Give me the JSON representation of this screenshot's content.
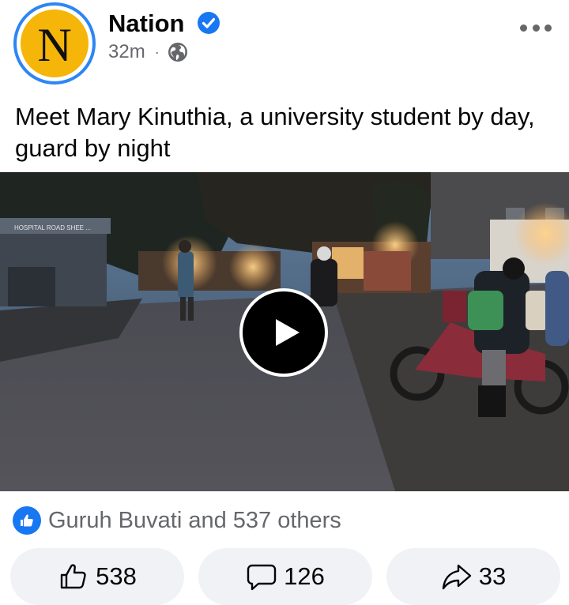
{
  "post": {
    "page_name": "Nation",
    "avatar_letter": "N",
    "time_ago": "32m",
    "separator": "·",
    "caption": "Meet Mary Kinuthia, a university student by day, guard by night",
    "video": {
      "storefront_sign": "HOSPITAL ROAD SHEE ...",
      "thumbnail": "evening street scene with pedestrians and a motorbike"
    }
  },
  "reactions": {
    "summary": "Guruh Buvati and 537 others"
  },
  "actions": {
    "like_count": "538",
    "comment_count": "126",
    "share_count": "33"
  },
  "colors": {
    "accent": "#1877f2",
    "secondary_text": "#65676b",
    "button_bg": "#f0f2f5",
    "avatar_bg": "#f5b509",
    "avatar_ring": "#2d86f2"
  },
  "icons": {
    "verified": "verified-badge-icon",
    "audience": "globe-icon",
    "more": "more-options-icon",
    "play": "play-icon",
    "like": "thumbs-up-icon",
    "comment": "comment-bubble-icon",
    "share": "share-arrow-icon"
  }
}
